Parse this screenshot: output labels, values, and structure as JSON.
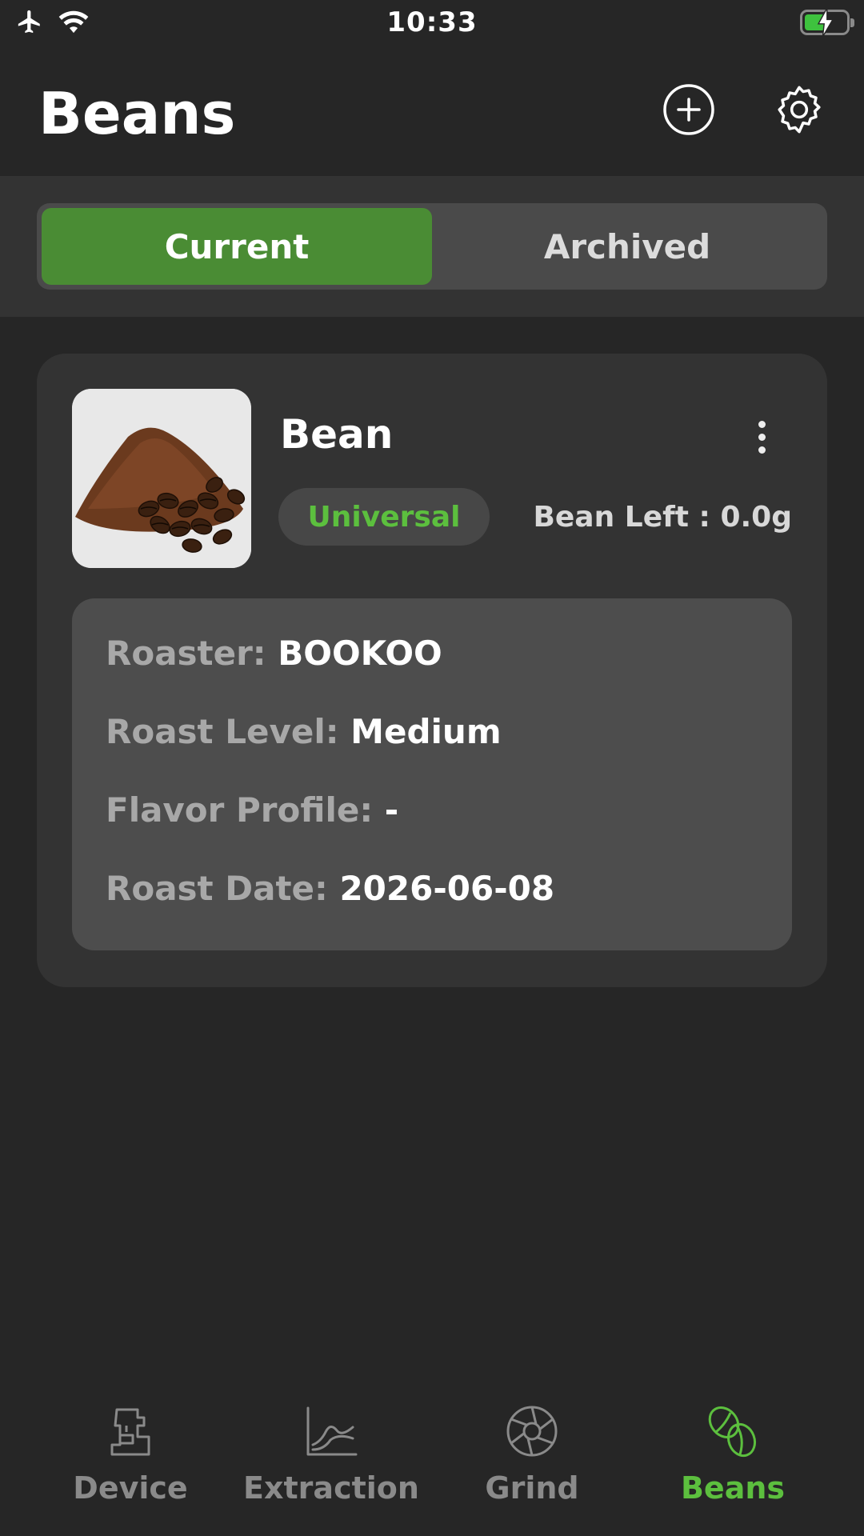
{
  "status_bar": {
    "time": "10:33",
    "icons": [
      "airplane-icon",
      "wifi-icon",
      "battery-charging-icon"
    ]
  },
  "header": {
    "title": "Beans",
    "add_icon": "plus-circle-icon",
    "settings_icon": "gear-icon"
  },
  "segment": {
    "tabs": [
      {
        "label": "Current",
        "selected": true
      },
      {
        "label": "Archived",
        "selected": false
      }
    ]
  },
  "bean_card": {
    "name": "Bean",
    "tag": "Universal",
    "bean_left": "Bean Left : 0.0g",
    "details": [
      {
        "key": "Roaster:",
        "value": "BOOKOO"
      },
      {
        "key": "Roast Level:",
        "value": "Medium"
      },
      {
        "key": "Flavor Profile:",
        "value": "-"
      },
      {
        "key": "Roast Date:",
        "value": "2026-06-08"
      }
    ]
  },
  "bottom_nav": {
    "items": [
      {
        "label": "Device",
        "icon": "espresso-machine-icon",
        "active": false
      },
      {
        "label": "Extraction",
        "icon": "chart-icon",
        "active": false
      },
      {
        "label": "Grind",
        "icon": "aperture-icon",
        "active": false
      },
      {
        "label": "Beans",
        "icon": "coffee-beans-icon",
        "active": true
      }
    ]
  },
  "colors": {
    "accent": "#5cbf3e",
    "selected_tab": "#4a8c34",
    "background": "#262626",
    "card": "#333333"
  }
}
